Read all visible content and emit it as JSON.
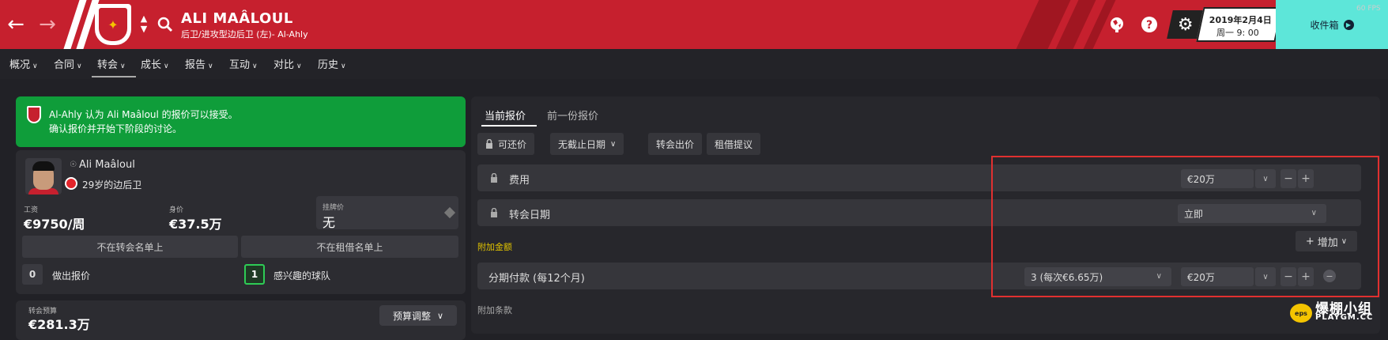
{
  "header": {
    "player_name": "ALI MAÂLOUL",
    "player_subtitle": "后卫/进攻型边后卫 (左)- Al-Ahly",
    "back_icon": "arrow-left-icon",
    "forward_icon": "arrow-right-icon",
    "fps": "60 FPS",
    "date": "2019年2月4日",
    "time": "周一 9: 00",
    "inbox_label": "收件箱",
    "accent": "#c6202e",
    "inbox_color": "#5de6d9"
  },
  "menu": {
    "items": [
      "概况",
      "合同",
      "转会",
      "成长",
      "报告",
      "互动",
      "对比",
      "历史"
    ],
    "active": "转会"
  },
  "notice": {
    "line1": "Al-Ahly 认为 Ali Maâloul 的报价可以接受。",
    "line2": "确认报价并开始下阶段的讨论。",
    "color": "#0f9d3a"
  },
  "player": {
    "name": "Ali Maâloul",
    "position": "29岁的边后卫",
    "wage_label": "工资",
    "wage": "€9750/周",
    "value_label": "身价",
    "value": "€37.5万",
    "listed_label": "挂牌价",
    "listed_value": "无",
    "transfer_list": "不在转会名单上",
    "loan_list": "不在租借名单上",
    "offers_count": "0",
    "offers_label": "做出报价",
    "interested_count": "1",
    "interested_label": "感兴趣的球队"
  },
  "budget": {
    "label": "转会预算",
    "value": "€281.3万",
    "button": "预算调整"
  },
  "offer": {
    "tabs": [
      "当前报价",
      "前一份报价"
    ],
    "negotiable": "可还价",
    "deadline": "无截止日期",
    "transfer_bid": "转会出价",
    "loan_offer": "租借提议",
    "fee_label": "费用",
    "fee_value": "€20万",
    "date_label": "转会日期",
    "date_value": "立即",
    "extras_label": "附加金额",
    "add_label": "增加",
    "installments_label": "分期付款 (每12个月)",
    "installments_value": "3 (每次€6.65万)",
    "installments_amount": "€20万",
    "terms_label": "附加条款"
  },
  "watermark": {
    "title": "爆棚小组",
    "site": "PLAYGM.CC",
    "logo": "eps"
  }
}
